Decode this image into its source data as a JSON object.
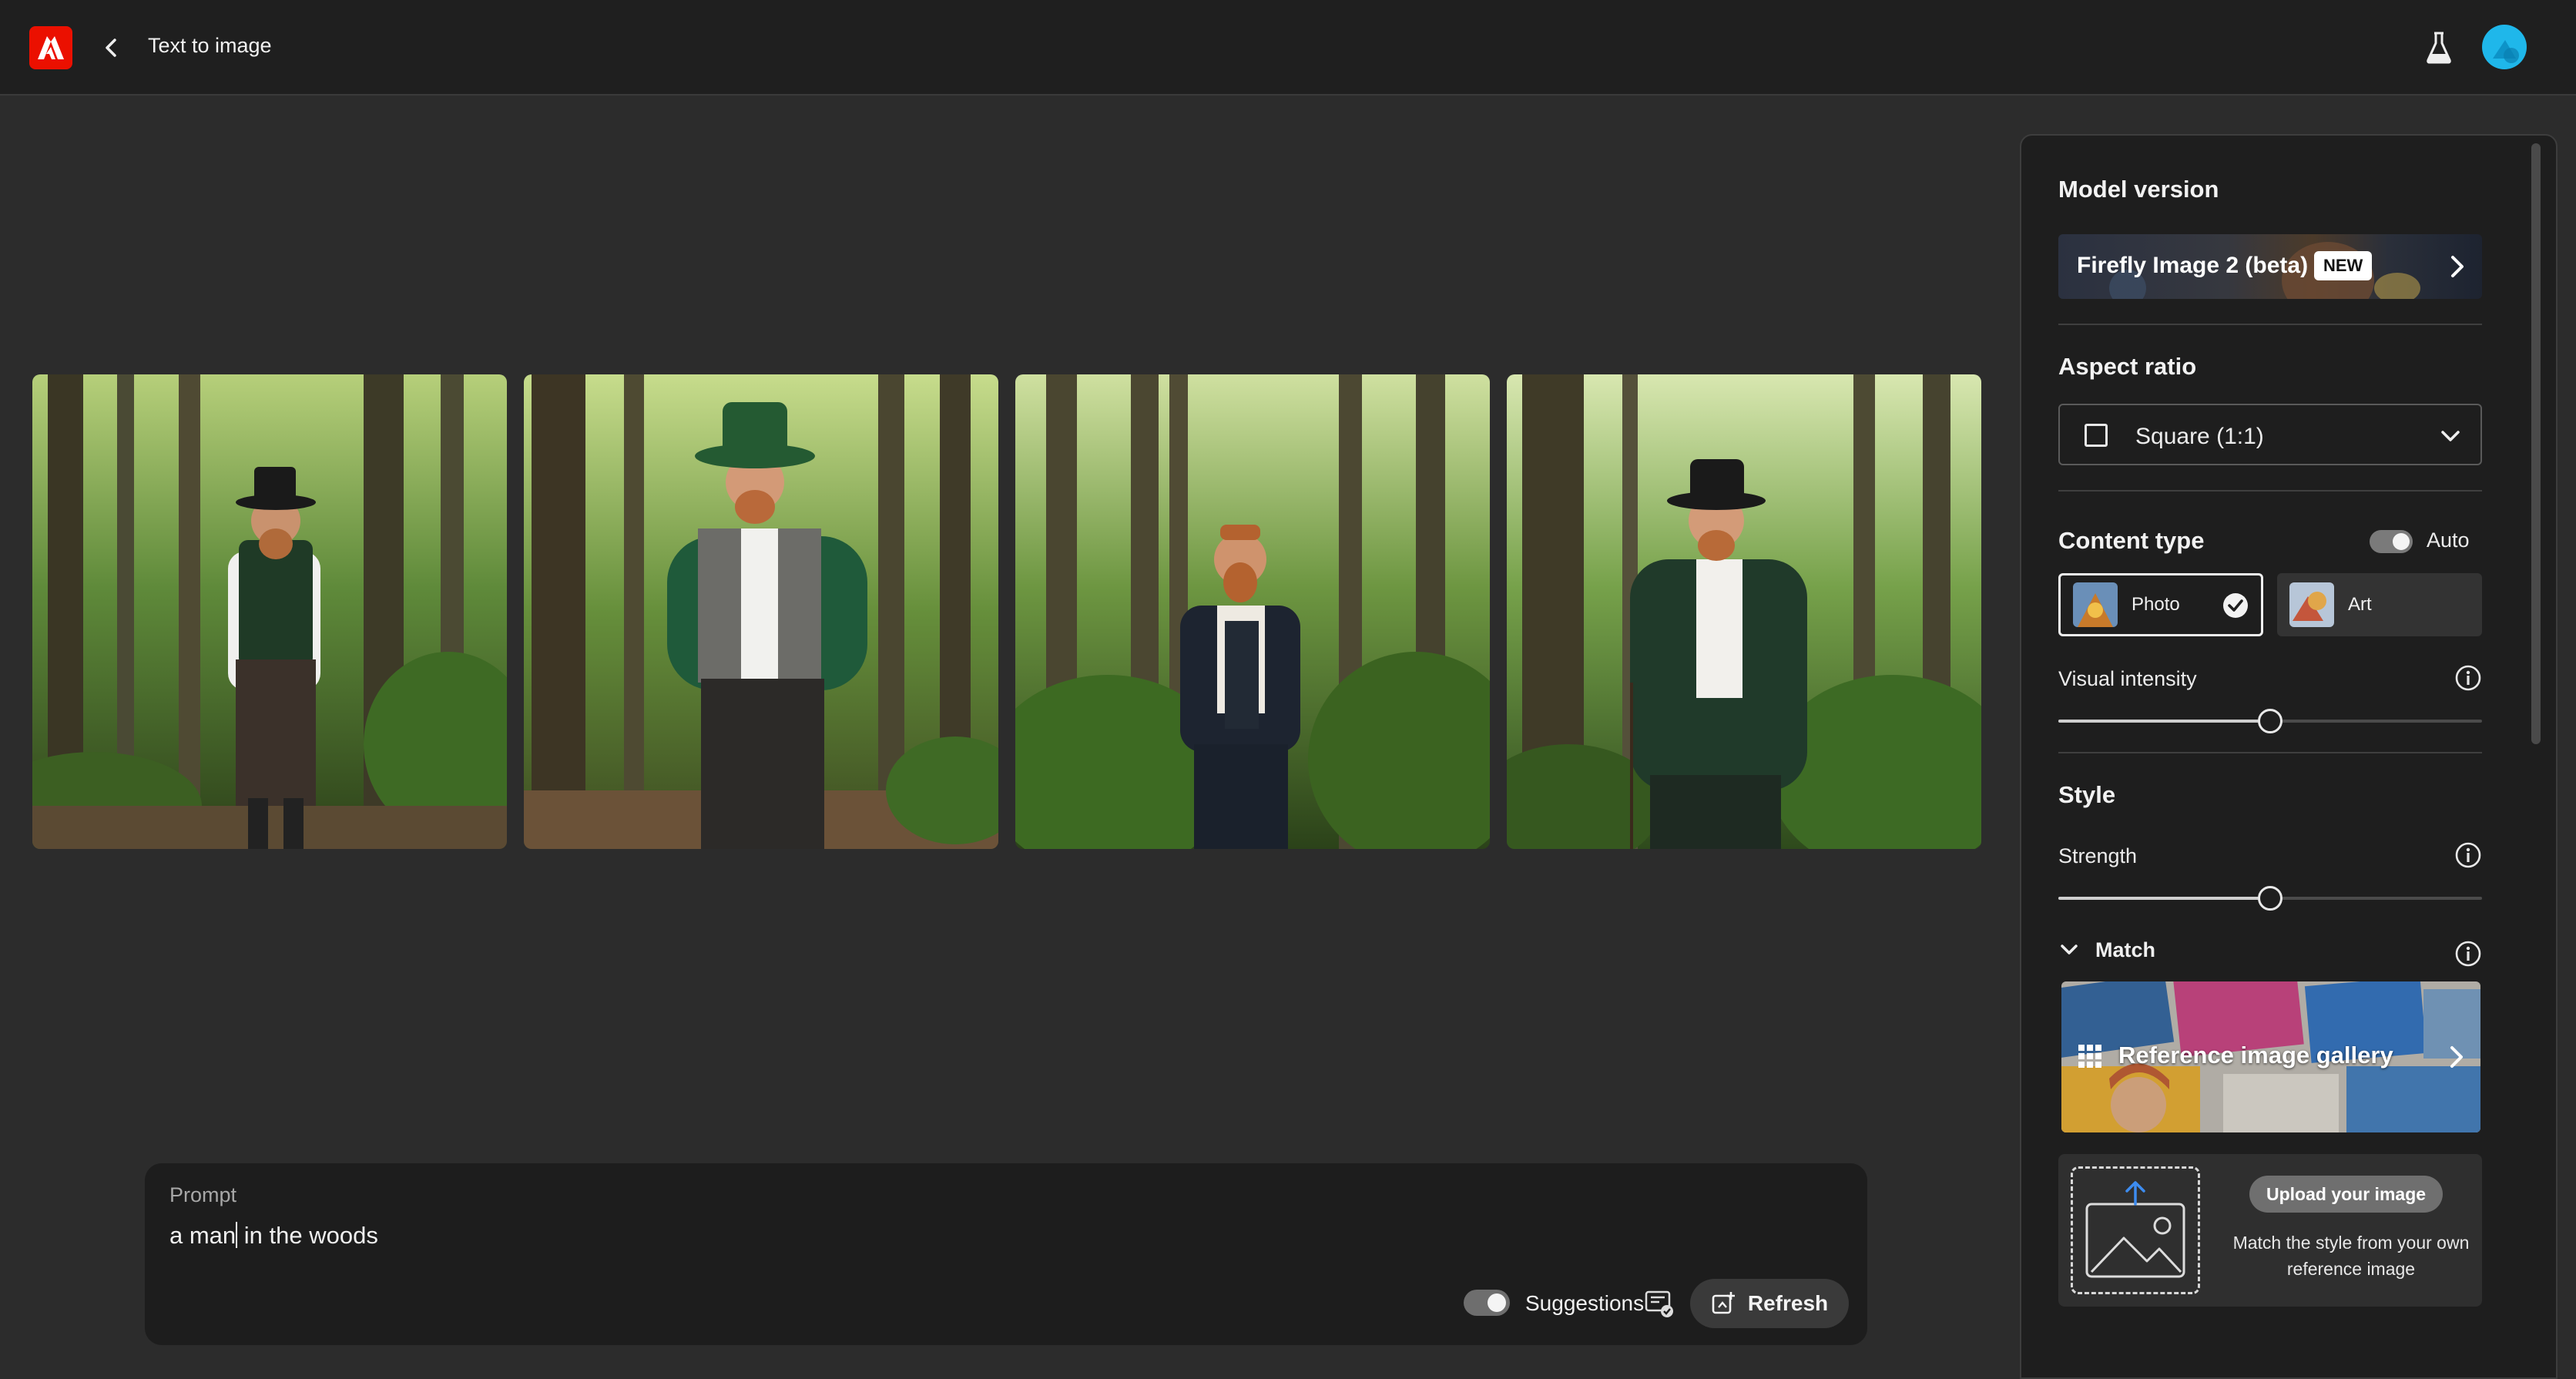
{
  "header": {
    "title": "Text to image"
  },
  "colors": {
    "brand": "#eb1000",
    "avatar": "#1fb7ea",
    "panel_bg": "#1e1e1e",
    "page_bg": "#2c2c2c"
  },
  "gallery_images": [
    {
      "icon": "generated-image"
    },
    {
      "icon": "generated-image"
    },
    {
      "icon": "generated-image"
    },
    {
      "icon": "generated-image"
    }
  ],
  "prompt": {
    "label": "Prompt",
    "value_before_caret": "a man",
    "value_after_caret": " in the woods",
    "suggestions_label": "Suggestions",
    "suggestions_on": true,
    "refresh_label": "Refresh"
  },
  "panel": {
    "model": {
      "heading": "Model version",
      "value": "Firefly Image 2 (beta)",
      "badge": "NEW"
    },
    "aspect": {
      "heading": "Aspect ratio",
      "value": "Square (1:1)"
    },
    "content_type": {
      "heading": "Content type",
      "auto_label": "Auto",
      "auto_on": true,
      "options": [
        {
          "label": "Photo",
          "selected": true
        },
        {
          "label": "Art",
          "selected": false
        }
      ]
    },
    "visual_intensity": {
      "label": "Visual intensity",
      "level": 0.5
    },
    "style": {
      "heading": "Style",
      "strength_label": "Strength",
      "strength_level": 0.5
    },
    "match": {
      "label": "Match",
      "gallery_label": "Reference image gallery",
      "upload_button": "Upload your image",
      "upload_desc": "Match the style from your own reference image"
    }
  }
}
